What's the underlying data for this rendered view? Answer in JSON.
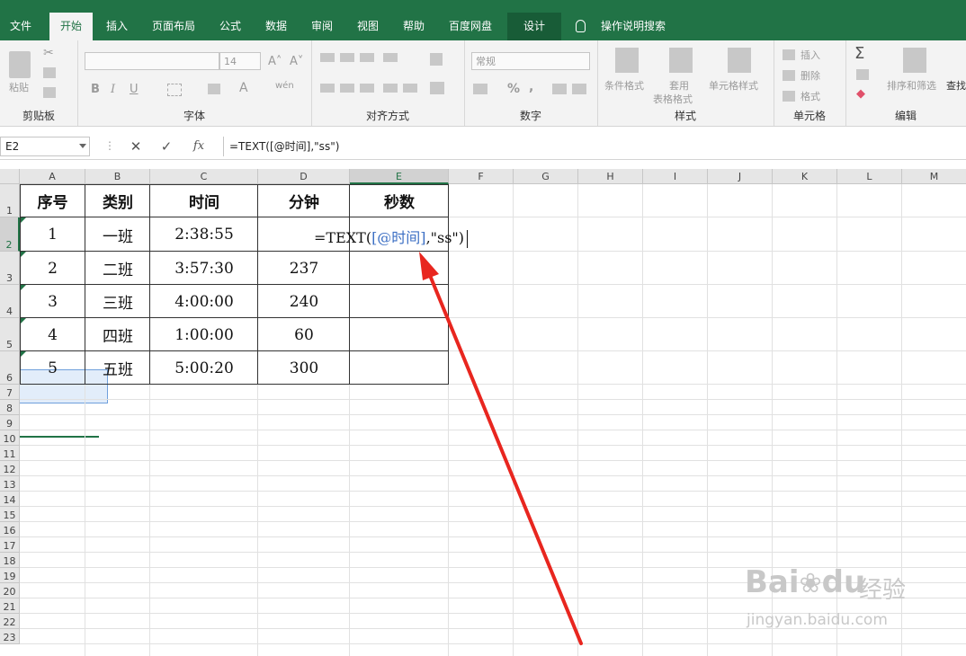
{
  "tabs": [
    "文件",
    "开始",
    "插入",
    "页面布局",
    "公式",
    "数据",
    "审阅",
    "视图",
    "帮助",
    "百度网盘",
    "设计"
  ],
  "active_tab": "开始",
  "tell_me": "操作说明搜索",
  "ribbon": {
    "clipboard": {
      "label": "剪贴板",
      "paste": "粘贴"
    },
    "font": {
      "label": "字体",
      "size": "14",
      "bold": "B",
      "italic": "I",
      "underline": "U"
    },
    "align": {
      "label": "对齐方式"
    },
    "number": {
      "label": "数字",
      "format": "常规",
      "percent": "%"
    },
    "styles": {
      "label": "样式",
      "cond": "条件格式",
      "table1": "套用",
      "table2": "表格格式",
      "cell": "单元格样式"
    },
    "cells": {
      "label": "单元格",
      "insert": "插入",
      "delete": "删除",
      "format": "格式"
    },
    "editing": {
      "label": "编辑",
      "sort": "排序和筛选",
      "find": "查找"
    }
  },
  "formula_bar": {
    "name_box": "E2",
    "formula": "=TEXT([@时间],\"ss\")",
    "cancel": "✕",
    "enter": "✓",
    "fx": "fx"
  },
  "columns": [
    "A",
    "B",
    "C",
    "D",
    "E",
    "F",
    "G",
    "H",
    "I",
    "J",
    "K",
    "L",
    "M"
  ],
  "rows": [
    "1",
    "2",
    "3",
    "4",
    "5",
    "6",
    "7",
    "8",
    "9",
    "10",
    "11",
    "12",
    "13",
    "14",
    "15",
    "16",
    "17",
    "18",
    "19",
    "20",
    "21",
    "22",
    "23"
  ],
  "table": {
    "headers": [
      "序号",
      "类别",
      "时间",
      "分钟",
      "秒数"
    ],
    "rows": [
      [
        "1",
        "一班",
        "2:38:55",
        ""
      ],
      [
        "2",
        "二班",
        "3:57:30",
        "237"
      ],
      [
        "3",
        "三班",
        "4:00:00",
        "240"
      ],
      [
        "4",
        "四班",
        "1:00:00",
        "60"
      ],
      [
        "5",
        "五班",
        "5:00:20",
        "300"
      ]
    ]
  },
  "edit": {
    "prefix": "=TEXT(",
    "ref": "[@时间]",
    "suffix": ",\"ss\")"
  },
  "watermark": {
    "brand": "Bai",
    "brand2": "du",
    "jingyan": "经验",
    "url": "jingyan.baidu.com"
  },
  "colors": {
    "accent": "#217346",
    "arrow": "#e8261f",
    "ref": "#3c6fc4"
  }
}
